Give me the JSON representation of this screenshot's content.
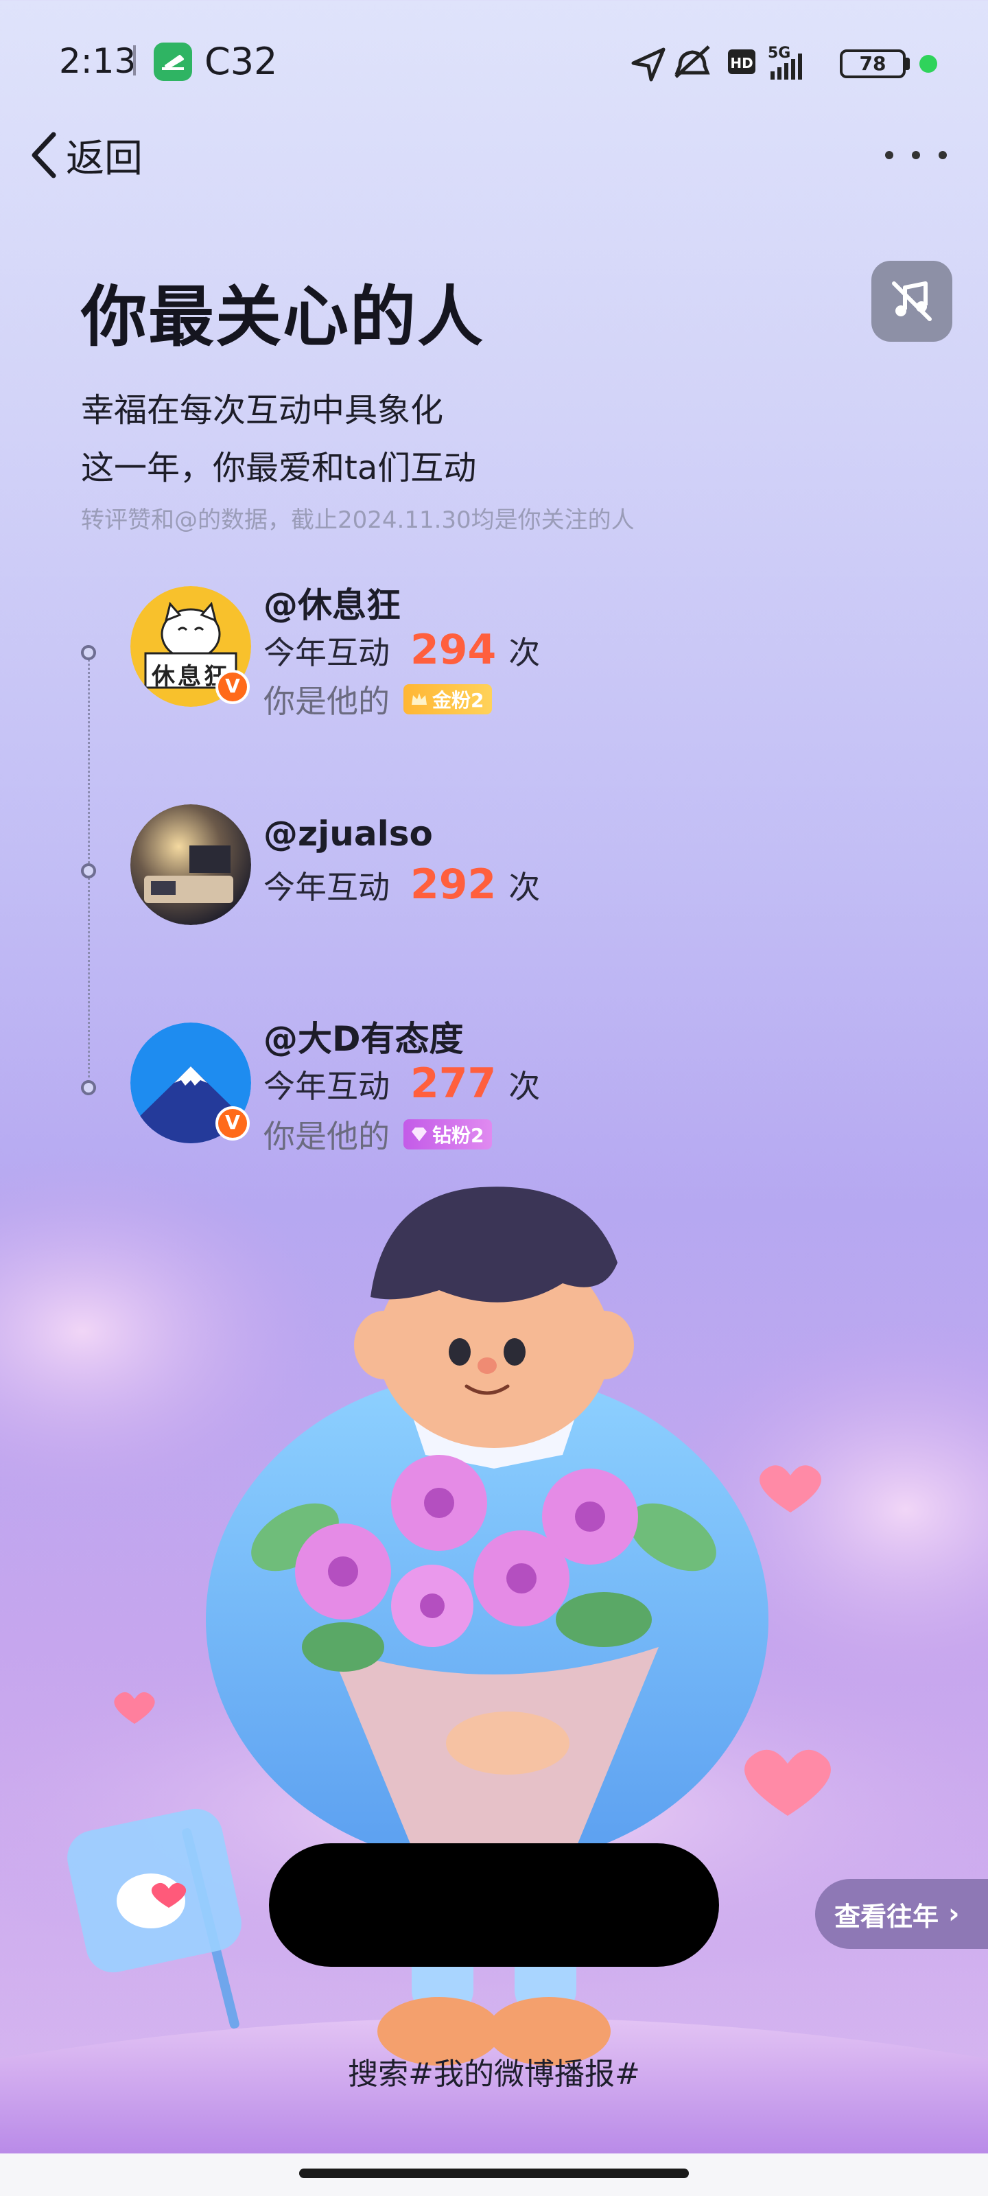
{
  "status_bar": {
    "time": "2:13",
    "carrier": "C32",
    "network": "5G",
    "hd": "HD",
    "battery": "78"
  },
  "nav": {
    "back_label": "返回"
  },
  "header": {
    "title": "你最关心的人",
    "subtitle_1": "幸福在每次互动中具象化",
    "subtitle_2": "这一年，你最爱和ta们互动",
    "note": "转评赞和@的数据，截止2024.11.30均是你关注的人"
  },
  "people": [
    {
      "handle": "@休息狂",
      "interaction_label": "今年互动",
      "count": "294",
      "unit": "次",
      "fan_label": "你是他的",
      "fan_badge": "金粉2",
      "avatar_text": "休息狂"
    },
    {
      "handle": "@zjualso",
      "interaction_label": "今年互动",
      "count": "292",
      "unit": "次"
    },
    {
      "handle": "@大D有态度",
      "interaction_label": "今年互动",
      "count": "277",
      "unit": "次",
      "fan_label": "你是他的",
      "fan_badge": "钻粉2"
    }
  ],
  "verified_mark": "V",
  "footer": {
    "past_years_label": "查看往年",
    "past_years_chevron": "›",
    "search_tag": "搜索#我的微博播报#"
  },
  "colors": {
    "count_accent": "#ff5f3d",
    "gold_badge": "#ffc13f",
    "diamond_badge": "#d071ec",
    "verified": "#ff6a1a"
  }
}
